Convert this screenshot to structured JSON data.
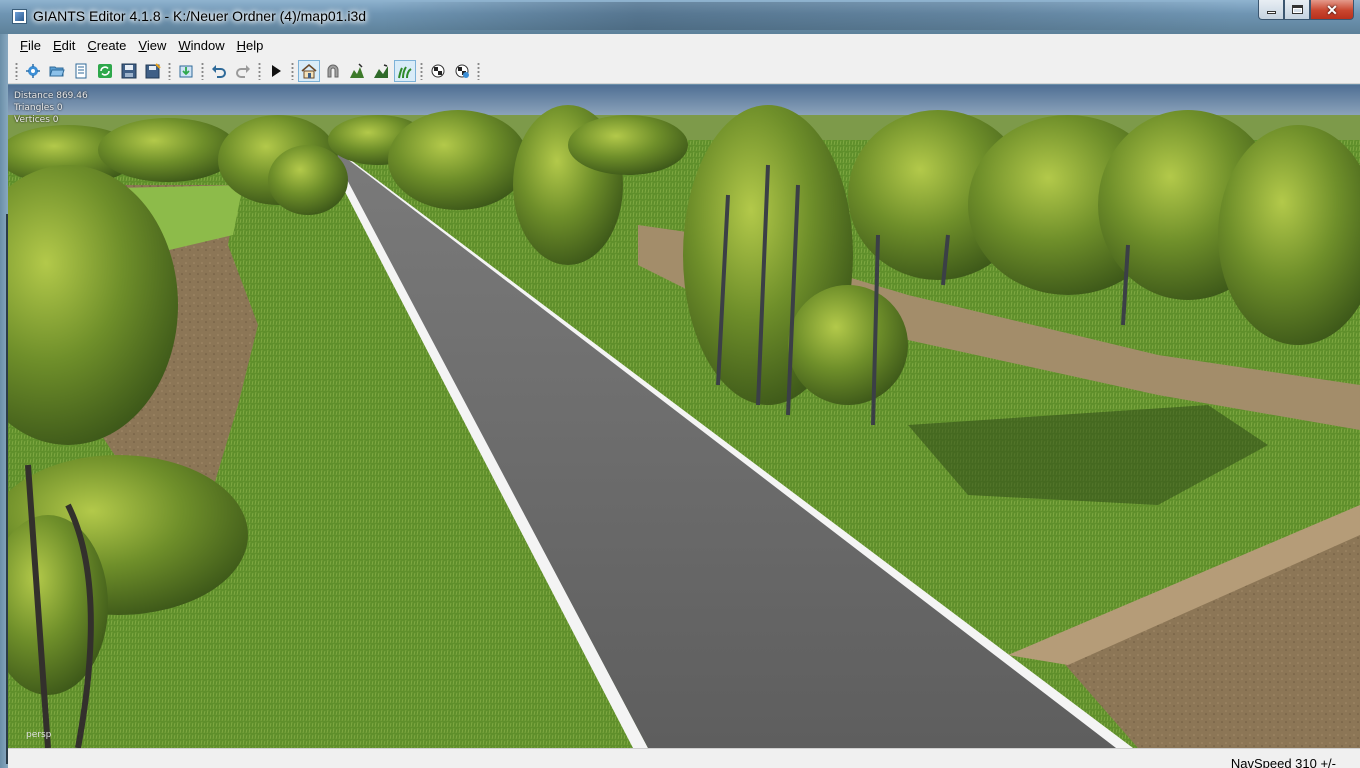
{
  "window": {
    "title": "GIANTS Editor 4.1.8 - K:/Neuer Ordner (4)/map01.i3d",
    "buttons": {
      "minimize": "minimize",
      "maximize": "maximize",
      "close": "✕"
    }
  },
  "menu": {
    "items": [
      {
        "key": "F",
        "rest": "ile"
      },
      {
        "key": "E",
        "rest": "dit"
      },
      {
        "key": "C",
        "rest": "reate"
      },
      {
        "key": "V",
        "rest": "iew"
      },
      {
        "key": "W",
        "rest": "indow"
      },
      {
        "key": "H",
        "rest": "elp"
      }
    ]
  },
  "toolbar": {
    "icons": [
      "new-scene-icon",
      "open-icon",
      "document-icon",
      "refresh-icon",
      "save-icon",
      "save-as-icon",
      "import-icon",
      "undo-icon",
      "redo-icon",
      "play-icon",
      "house-icon",
      "magnet-icon",
      "terrain-sculpt-icon",
      "terrain-paint-icon",
      "foliage-paint-icon",
      "checker-icon",
      "checker-settings-icon"
    ],
    "active": [
      "house-icon",
      "foliage-paint-icon"
    ]
  },
  "viewport": {
    "stats": {
      "distance": "Distance 869.46",
      "triangles": "Triangles 0",
      "vertices": "Vertices 0"
    },
    "camera_label": "persp"
  },
  "statusbar": {
    "nav_speed": "NavSpeed 310 +/-"
  },
  "colors": {
    "grass": "#5e8a2a",
    "road": "#6b6b6b",
    "dirt": "#8f7a5c",
    "tree": "#4f6e1c",
    "sky": "#6b8fb5"
  }
}
